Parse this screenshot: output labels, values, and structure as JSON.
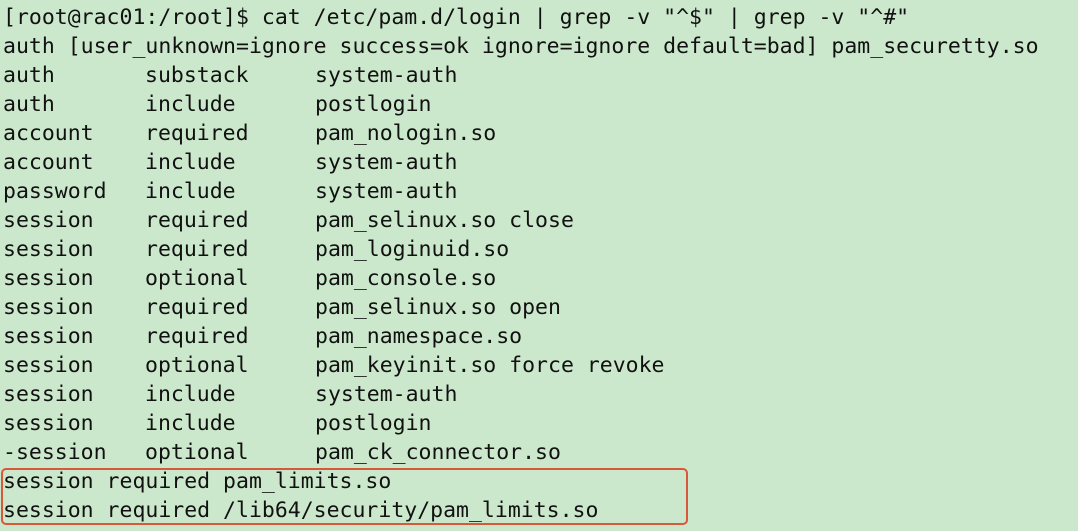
{
  "terminal": {
    "prompt": "[root@rac01:/root]$ cat /etc/pam.d/login | grep -v \"^$\" | grep -v \"^#\"",
    "first_line": "auth [user_unknown=ignore success=ok ignore=ignore default=bad] pam_securetty.so",
    "rows": [
      {
        "type": "auth",
        "control": "substack",
        "module": "system-auth"
      },
      {
        "type": "auth",
        "control": "include",
        "module": "postlogin"
      },
      {
        "type": "account",
        "control": "required",
        "module": "pam_nologin.so"
      },
      {
        "type": "account",
        "control": "include",
        "module": "system-auth"
      },
      {
        "type": "password",
        "control": "include",
        "module": "system-auth"
      },
      {
        "type": "session",
        "control": "required",
        "module": "pam_selinux.so close"
      },
      {
        "type": "session",
        "control": "required",
        "module": "pam_loginuid.so"
      },
      {
        "type": "session",
        "control": "optional",
        "module": "pam_console.so"
      },
      {
        "type": "session",
        "control": "required",
        "module": "pam_selinux.so open"
      },
      {
        "type": "session",
        "control": "required",
        "module": "pam_namespace.so"
      },
      {
        "type": "session",
        "control": "optional",
        "module": "pam_keyinit.so force revoke"
      },
      {
        "type": "session",
        "control": "include",
        "module": "system-auth"
      },
      {
        "type": "session",
        "control": "include",
        "module": "postlogin"
      },
      {
        "type": "-session",
        "control": "optional",
        "module": "pam_ck_connector.so"
      }
    ],
    "highlighted_lines": [
      "session required pam_limits.so",
      "session required /lib64/security/pam_limits.so"
    ]
  },
  "colors": {
    "background": "#cce8cc",
    "text": "#111111",
    "highlight_border": "#d9573a"
  }
}
